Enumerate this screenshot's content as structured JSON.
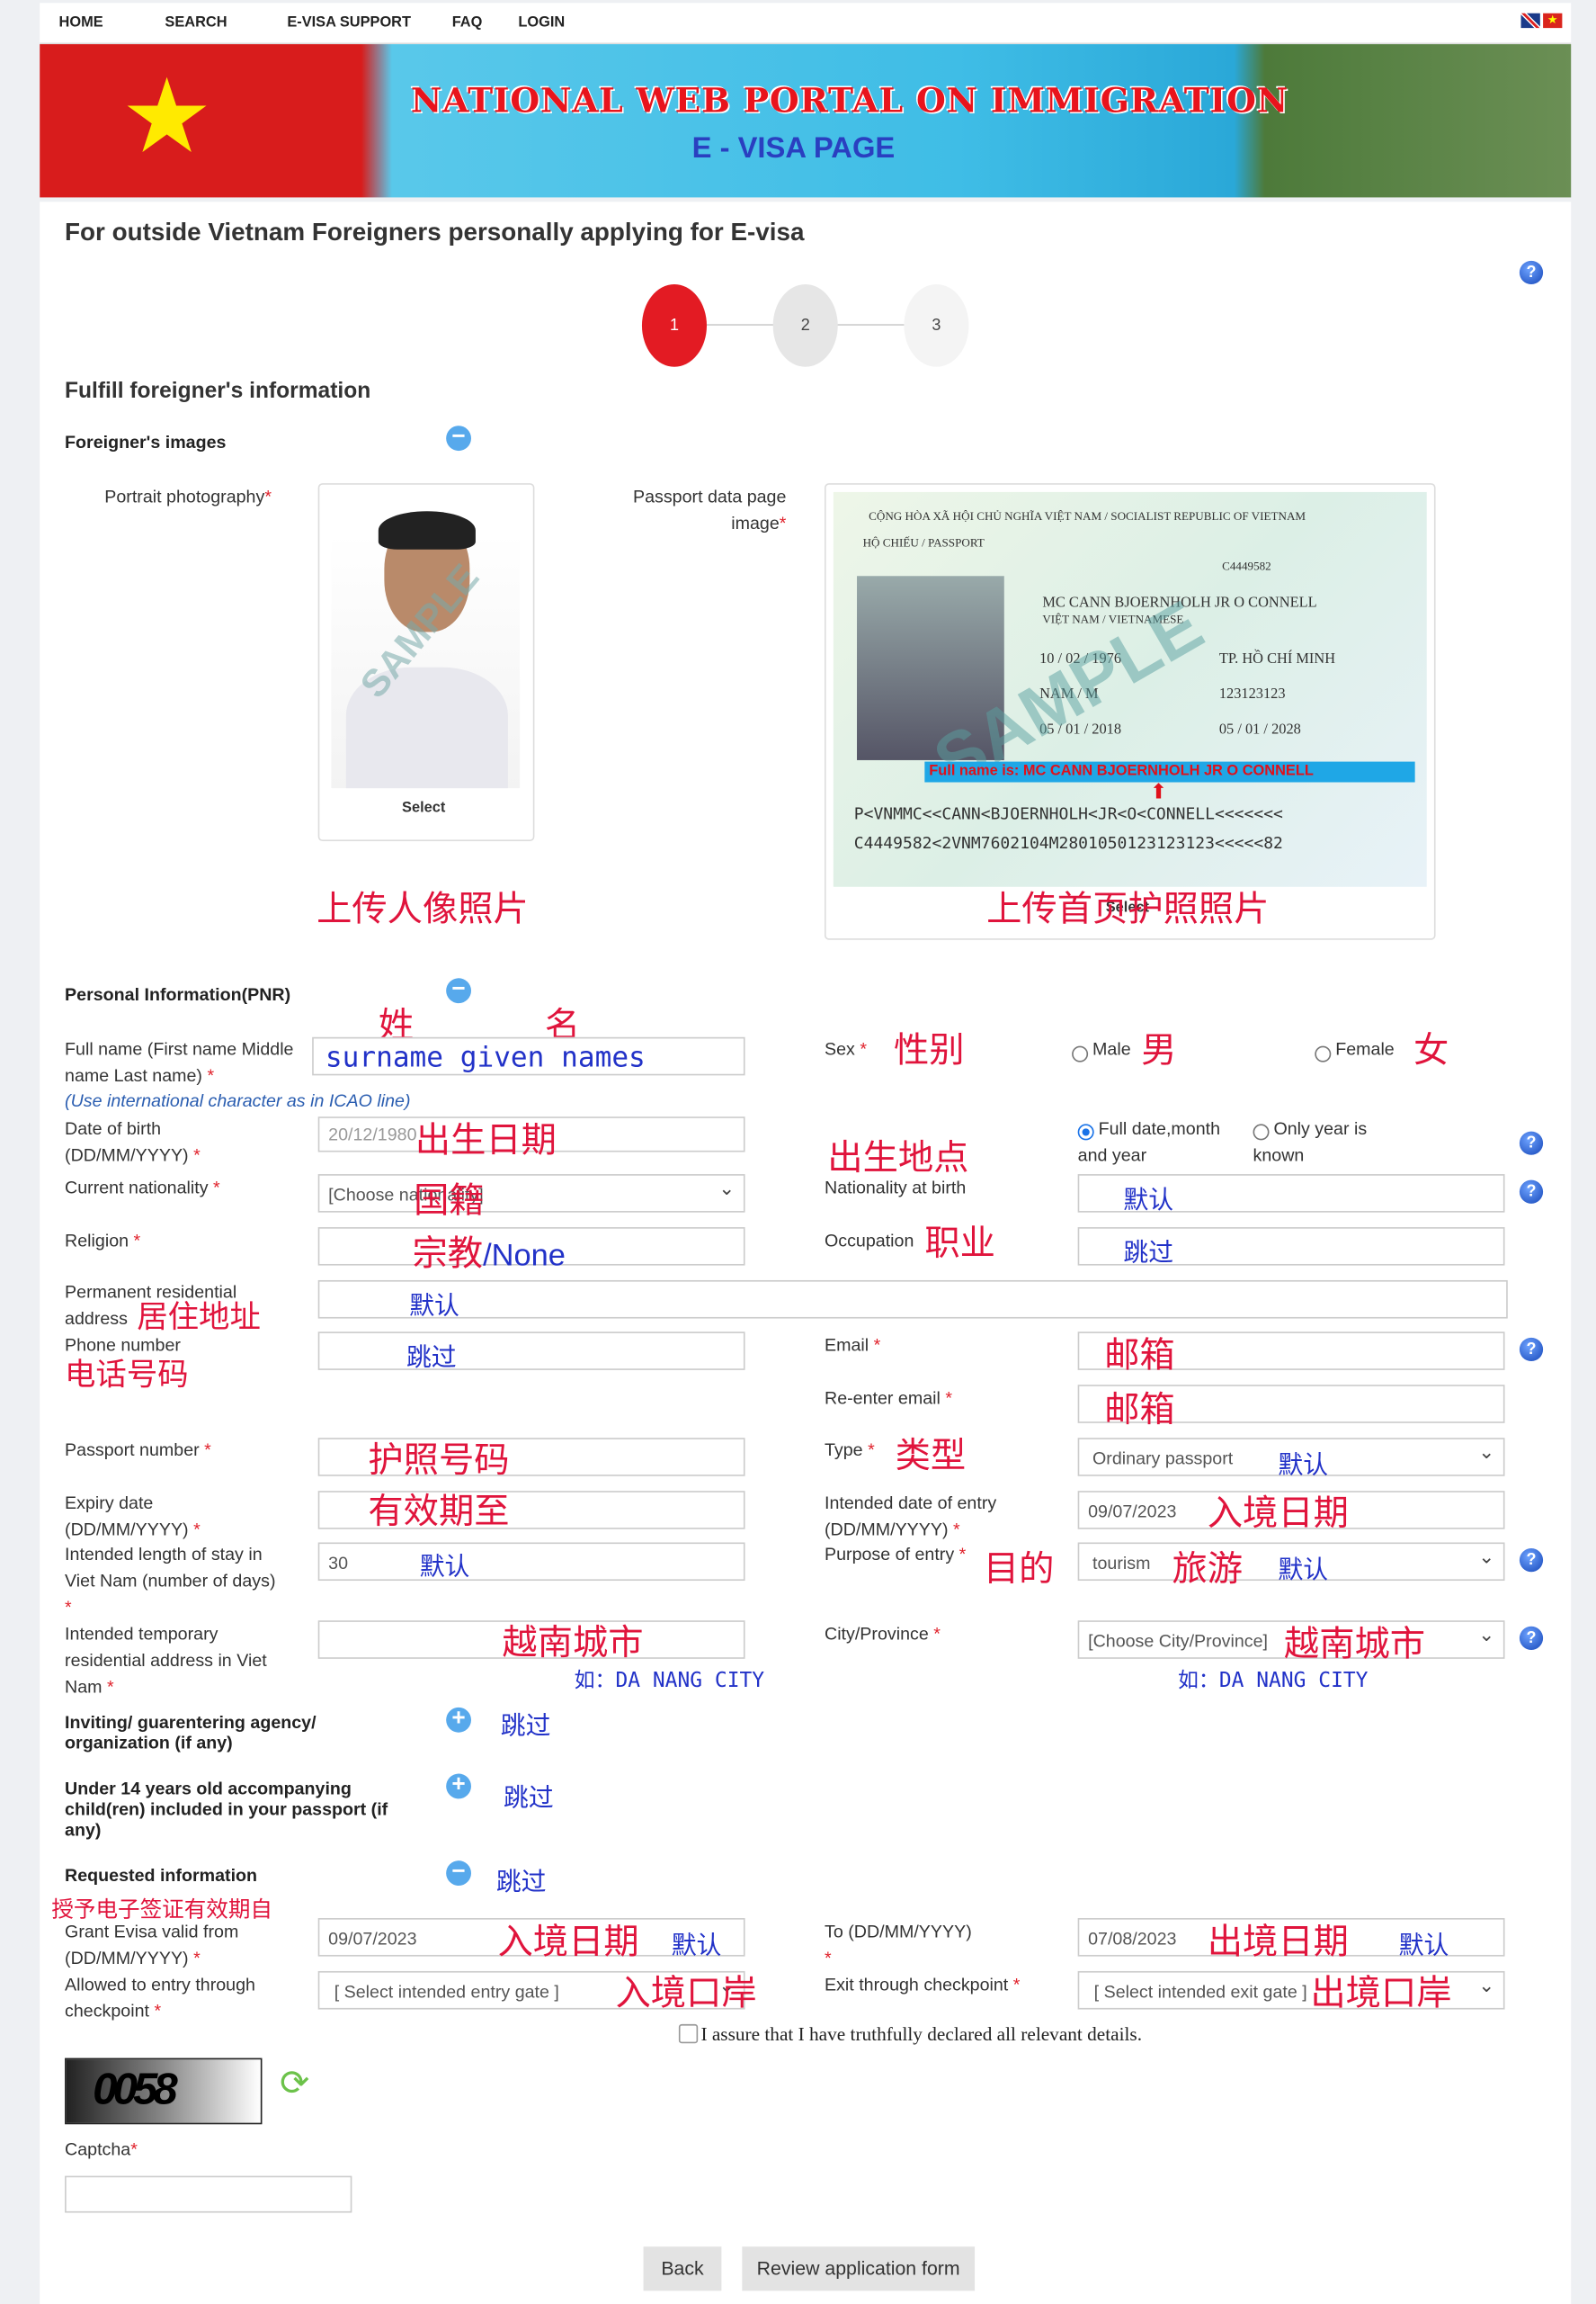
{
  "nav": {
    "items": [
      "HOME",
      "SEARCH",
      "E-VISA SUPPORT",
      "FAQ",
      "LOGIN"
    ],
    "flags": [
      "uk-flag-icon",
      "vietnam-flag-icon"
    ]
  },
  "banner": {
    "title": "NATIONAL WEB PORTAL ON IMMIGRATION",
    "subtitle": "E - VISA PAGE"
  },
  "page": {
    "title": "For outside Vietnam Foreigners personally applying for E-visa",
    "section_title": "Fulfill foreigner's information"
  },
  "steps": [
    {
      "label": "1",
      "active": true
    },
    {
      "label": "2",
      "active": false
    },
    {
      "label": "3",
      "active": false
    }
  ],
  "images": {
    "heading": "Foreigner's images",
    "portrait_label": "Portrait photography",
    "passport_label": "Passport data page image",
    "select": "Select",
    "watermark": "SAMPLE",
    "passport": {
      "header": "CỘNG HÒA XÃ HỘI CHỦ NGHĨA VIỆT NAM / SOCIALIST REPUBLIC OF VIETNAM",
      "type_line": "HỘ CHIẾU / PASSPORT",
      "passport_no": "C4449582",
      "name": "MC CANN BJOERNHOLH JR O CONNELL",
      "nationality": "VIỆT NAM / VIETNAMESE",
      "dob": "10 / 02 / 1976",
      "place": "TP. HỒ CHÍ MINH",
      "sex": "NAM / M",
      "id_no": "123123123",
      "issue": "05 / 01 / 2018",
      "expiry": "05 / 01 / 2028",
      "banner": "Full name is: MC CANN BJOERNHOLH JR O CONNELL",
      "mrz1": "P<VNMMC<<CANN<BJOERNHOLH<JR<O<CONNELL<<<<<<<",
      "mrz2": "C4449582<2VNM7602104M2801050123123123<<<<<82"
    },
    "notes": {
      "portrait": "上传人像照片",
      "passport": "上传首页护照照片"
    }
  },
  "personal": {
    "heading": "Personal Information(PNR)",
    "notes": {
      "surname": "姓",
      "given": "名"
    },
    "full_name": {
      "label": "Full name (First name Middle name Last name)",
      "value": "surname given names",
      "hint": "(Use international character as in ICAO line)"
    },
    "sex": {
      "label": "Sex",
      "note": "性别",
      "male": "Male",
      "male_note": "男",
      "female": "Female",
      "female_note": "女"
    },
    "dob": {
      "label": "Date of birth (DD/MM/YYYY)",
      "value": "20/12/1980",
      "note": "出生日期",
      "opt_full": "Full date,month and year",
      "opt_year": "Only year is known",
      "place_note": "出生地点"
    },
    "nationality": {
      "label": "Current nationality",
      "value": "[Choose nationality]",
      "note": "国籍"
    },
    "nationality_birth": {
      "label": "Nationality at birth",
      "note": "默认"
    },
    "religion": {
      "label": "Religion",
      "note": "宗教",
      "value": "/None"
    },
    "occupation": {
      "label": "Occupation",
      "note": "职业",
      "value_note": "跳过"
    },
    "address": {
      "label": "Permanent residential address",
      "note": "居住地址",
      "value_note": "默认"
    },
    "phone": {
      "label": "Phone number",
      "note": "电话号码",
      "value_note": "跳过"
    },
    "email": {
      "label": "Email",
      "note": "邮箱"
    },
    "reemail": {
      "label": "Re-enter email",
      "note": "邮箱"
    },
    "passport_no": {
      "label": "Passport number",
      "note": "护照号码"
    },
    "type": {
      "label": "Type",
      "note": "类型",
      "value": "Ordinary passport",
      "value_note": "默认"
    },
    "expiry": {
      "label": "Expiry date (DD/MM/YYYY)",
      "note": "有效期至"
    },
    "entry_date": {
      "label": "Intended date of entry (DD/MM/YYYY)",
      "value": "09/07/2023",
      "note": "入境日期"
    },
    "stay": {
      "label": "Intended length of stay in Viet Nam (number of days)",
      "value": "30",
      "note": "默认"
    },
    "purpose": {
      "label": "Purpose of entry",
      "note": "目的",
      "value": "tourism",
      "value_note": "旅游",
      "default_note": "默认"
    },
    "temp_address": {
      "label": "Intended temporary residential address in Viet Nam",
      "note": "越南城市",
      "example": "如：DA NANG CITY"
    },
    "city": {
      "label": "City/Province",
      "value": "[Choose City/Province]",
      "note": "越南城市",
      "example": "如：DA NANG CITY"
    }
  },
  "inviting": {
    "label": "Inviting/ guarentering agency/ organization (if any)",
    "note": "跳过"
  },
  "children": {
    "label": "Under 14 years old accompanying child(ren) included in your passport (if any)",
    "note": "跳过"
  },
  "requested": {
    "heading": "Requested information",
    "heading_note": "跳过",
    "note": "授予电子签证有效期自",
    "valid_from": {
      "label": "Grant Evisa valid from (DD/MM/YYYY)",
      "value": "09/07/2023",
      "note": "入境日期",
      "default_note": "默认"
    },
    "valid_to": {
      "label": "To (DD/MM/YYYY)",
      "value": "07/08/2023",
      "note": "出境日期",
      "default_note": "默认"
    },
    "entry_gate": {
      "label": "Allowed to entry through checkpoint",
      "value": "[ Select intended entry gate ]",
      "note": "入境口岸"
    },
    "exit_gate": {
      "label": "Exit through checkpoint",
      "value": "[ Select intended exit gate ]",
      "note": "出境口岸"
    }
  },
  "assure": "I assure that I have truthfully declared all relevant details.",
  "captcha": {
    "image_text": "0058",
    "label": "Captcha",
    "value": ""
  },
  "buttons": {
    "back": "Back",
    "review": "Review application form"
  },
  "colors": {
    "accent_red": "#e31b23",
    "annotation_red": "#e0143c",
    "annotation_blue": "#2232c8",
    "help_blue": "#1546b8"
  }
}
